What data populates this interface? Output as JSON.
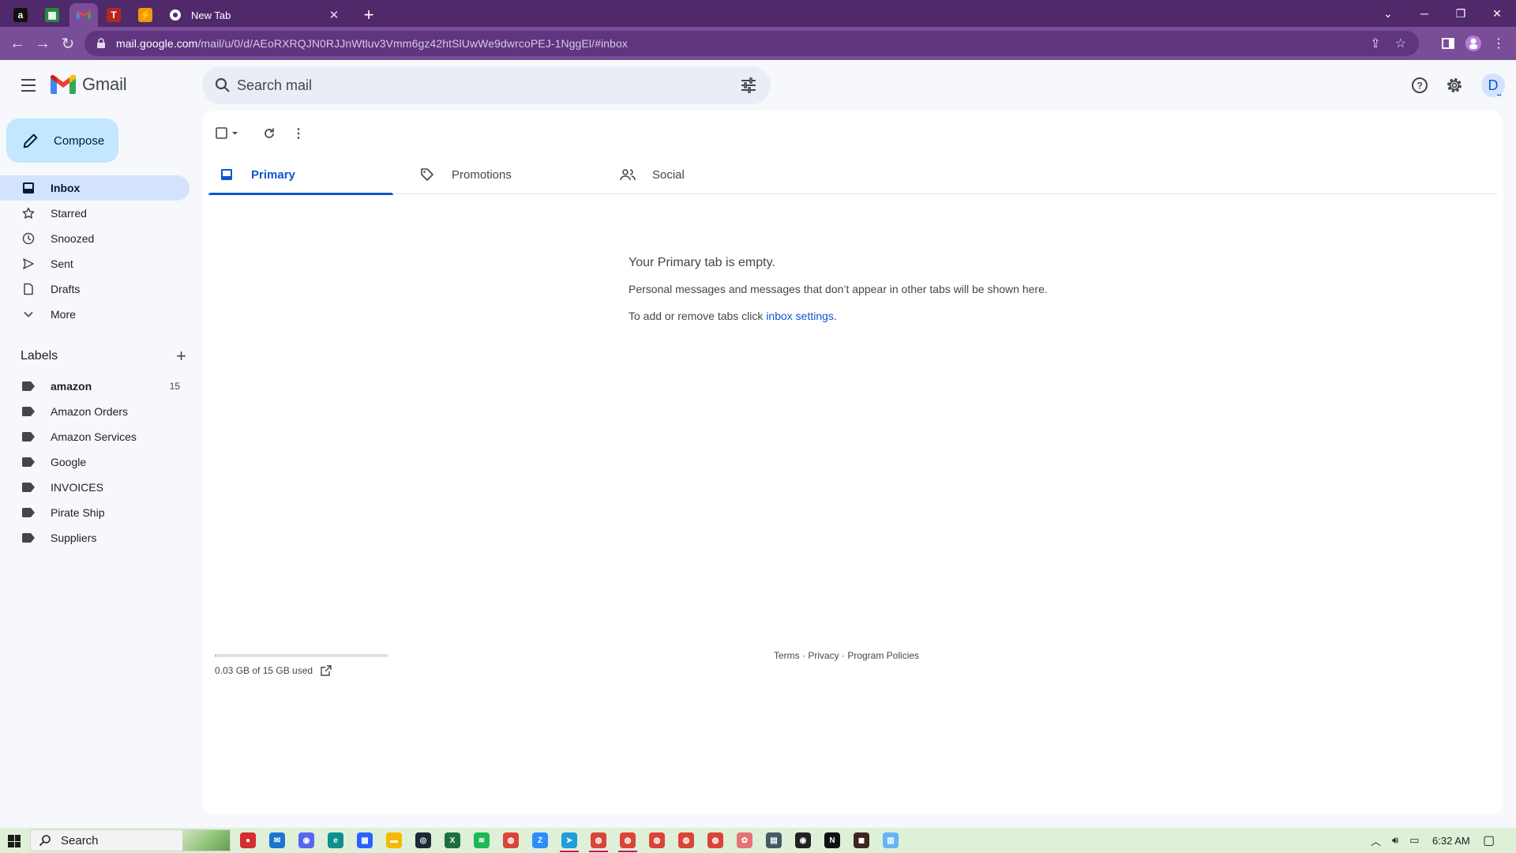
{
  "browser": {
    "pinned_tabs": [
      {
        "icon": "amazon-favicon-icon",
        "glyph": "a",
        "color": "#111111"
      },
      {
        "icon": "sheets-favicon-icon",
        "glyph": "",
        "color": "#1e8e3e"
      },
      {
        "icon": "gmail-favicon-icon",
        "glyph": "M",
        "color": "#7a4d99"
      },
      {
        "icon": "app-favicon-icon",
        "glyph": "T",
        "color": "#b3261e"
      },
      {
        "icon": "app-favicon-icon",
        "glyph": "",
        "color": "#f29900"
      }
    ],
    "active_tab_title": "New Tab",
    "url_host": "mail.google.com",
    "url_path": "/mail/u/0/d/AEoRXRQJN0RJJnWtluv3Vmm6gz42htSlUwWe9dwrcoPEJ-1NggEl/#inbox"
  },
  "gmail": {
    "logo_text": "Gmail",
    "search_placeholder": "Search mail",
    "avatar_letter": "D",
    "compose_label": "Compose",
    "nav": [
      {
        "label": "Inbox",
        "icon": "inbox-icon",
        "active": true
      },
      {
        "label": "Starred",
        "icon": "star-icon"
      },
      {
        "label": "Snoozed",
        "icon": "clock-icon"
      },
      {
        "label": "Sent",
        "icon": "send-icon"
      },
      {
        "label": "Drafts",
        "icon": "draft-icon"
      },
      {
        "label": "More",
        "icon": "chevron-down-icon"
      }
    ],
    "labels_title": "Labels",
    "labels": [
      {
        "name": "amazon",
        "count": "15",
        "bold": true
      },
      {
        "name": "Amazon Orders"
      },
      {
        "name": "Amazon Services"
      },
      {
        "name": "Google"
      },
      {
        "name": "INVOICES"
      },
      {
        "name": "Pirate Ship"
      },
      {
        "name": "Suppliers"
      }
    ],
    "tabs": [
      {
        "label": "Primary",
        "icon": "inbox-tab-icon",
        "active": true
      },
      {
        "label": "Promotions",
        "icon": "tag-icon"
      },
      {
        "label": "Social",
        "icon": "people-icon"
      }
    ],
    "empty_title": "Your Primary tab is empty.",
    "empty_desc": "Personal messages and messages that don’t appear in other tabs will be shown here.",
    "empty_hint_prefix": "To add or remove tabs click ",
    "empty_hint_link": "inbox settings",
    "empty_hint_suffix": ".",
    "storage_text": "0.03 GB of 15 GB used",
    "storage_fraction": 0.002,
    "footer": "Terms · Privacy · Program Policies"
  },
  "taskbar": {
    "search_label": "Search",
    "time": "6:32 AM",
    "apps": [
      {
        "name": "app-icon",
        "color": "#d32f2f",
        "glyph": "●"
      },
      {
        "name": "mail-app-icon",
        "color": "#1976d2",
        "glyph": "✉"
      },
      {
        "name": "discord-icon",
        "color": "#5865f2",
        "glyph": "◉"
      },
      {
        "name": "edge-icon",
        "color": "#0c8f8f",
        "glyph": "e"
      },
      {
        "name": "store-icon",
        "color": "#2962ff",
        "glyph": "▦"
      },
      {
        "name": "file-explorer-icon",
        "color": "#f6b900",
        "glyph": "▬"
      },
      {
        "name": "steam-icon",
        "color": "#1b2838",
        "glyph": "◎"
      },
      {
        "name": "excel-icon",
        "color": "#1d6f42",
        "glyph": "X"
      },
      {
        "name": "spotify-icon",
        "color": "#1db954",
        "glyph": "≋"
      },
      {
        "name": "chrome-icon",
        "color": "#db4437",
        "glyph": "◍"
      },
      {
        "name": "zoom-icon",
        "color": "#2d8cff",
        "glyph": "Z"
      },
      {
        "name": "telegram-icon",
        "color": "#229ed9",
        "glyph": "➤"
      },
      {
        "name": "chrome-profile-icon",
        "color": "#db4437",
        "glyph": "◍"
      },
      {
        "name": "chrome-profile-icon",
        "color": "#db4437",
        "glyph": "◍"
      },
      {
        "name": "chrome-profile-icon",
        "color": "#db4437",
        "glyph": "◍"
      },
      {
        "name": "chrome-profile-icon",
        "color": "#db4437",
        "glyph": "◍"
      },
      {
        "name": "chrome-profile-icon",
        "color": "#db4437",
        "glyph": "◍"
      },
      {
        "name": "paint-icon",
        "color": "#e57373",
        "glyph": "✿"
      },
      {
        "name": "calculator-icon",
        "color": "#455a64",
        "glyph": "▤"
      },
      {
        "name": "obs-icon",
        "color": "#222222",
        "glyph": "◉"
      },
      {
        "name": "netflix-icon",
        "color": "#111111",
        "glyph": "N"
      },
      {
        "name": "app-icon",
        "color": "#3e2723",
        "glyph": "◼"
      },
      {
        "name": "notepad-icon",
        "color": "#64b5f6",
        "glyph": "▥"
      }
    ]
  }
}
